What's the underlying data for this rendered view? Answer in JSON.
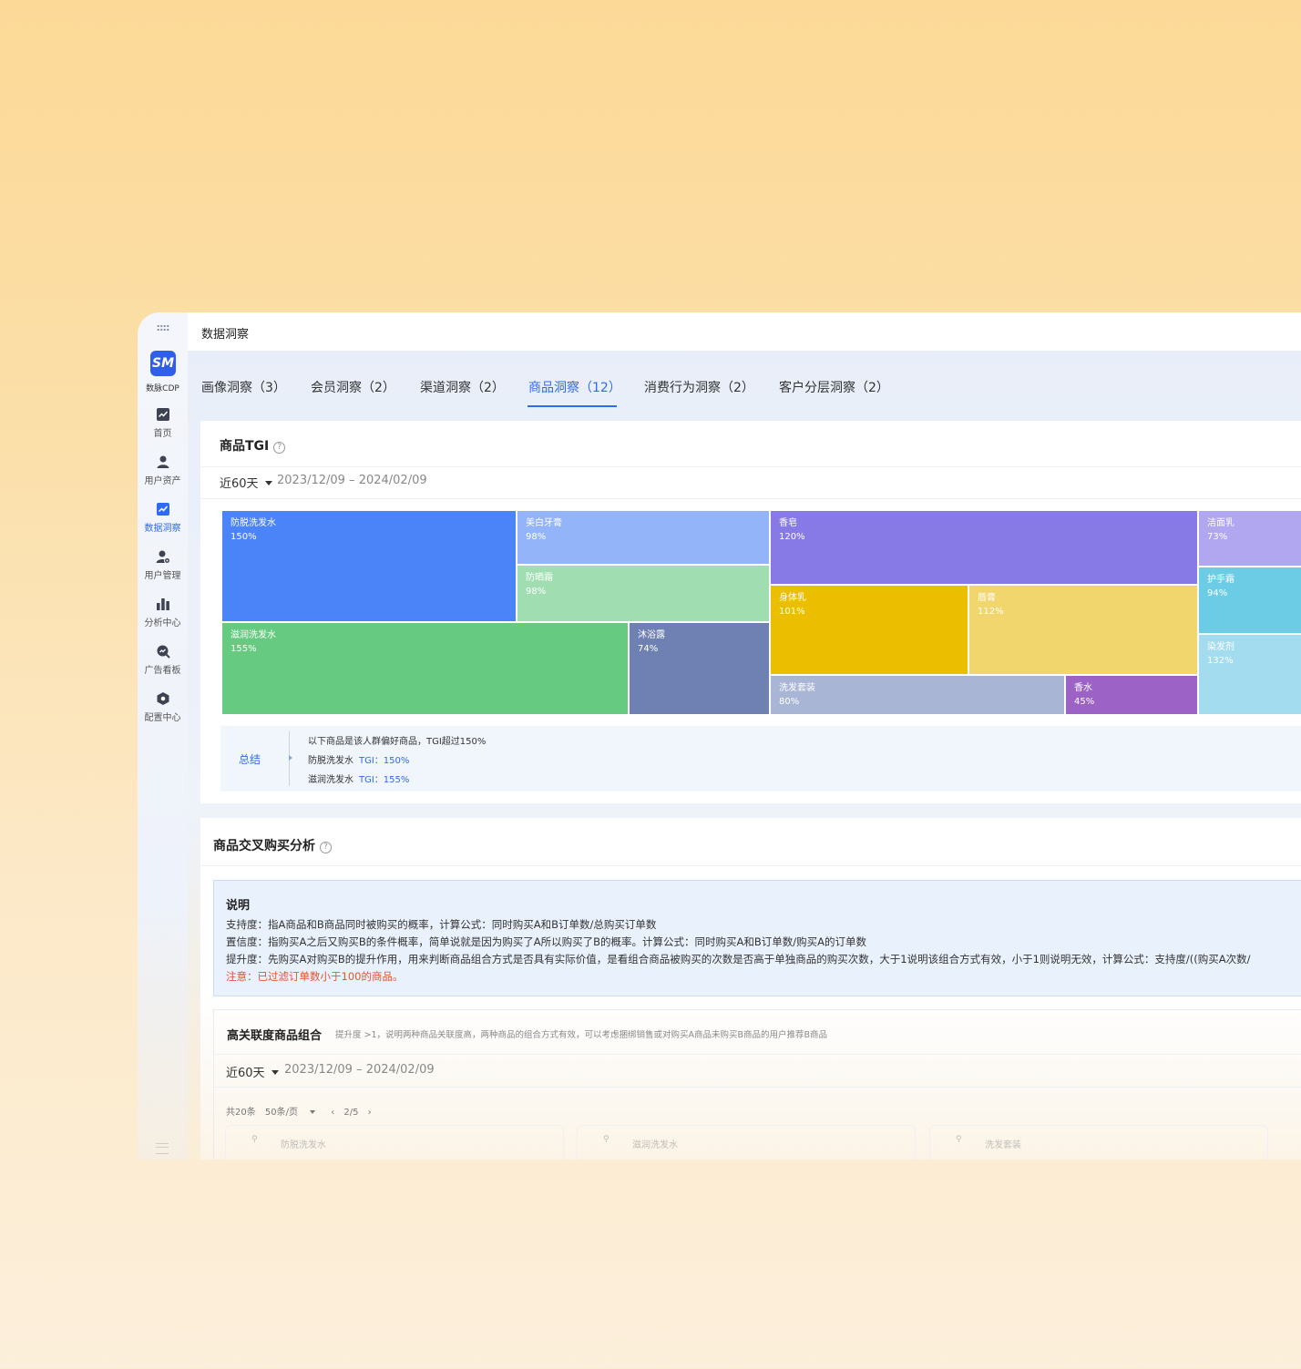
{
  "sidebar": {
    "logo_text": "SM",
    "logo_label": "数脉CDP",
    "items": [
      {
        "label": "首页",
        "icon": "chart-line-icon"
      },
      {
        "label": "用户资产",
        "icon": "user-icon"
      },
      {
        "label": "数据洞察",
        "icon": "insight-chart-icon",
        "active": true
      },
      {
        "label": "用户管理",
        "icon": "user-settings-icon"
      },
      {
        "label": "分析中心",
        "icon": "bar-chart-icon"
      },
      {
        "label": "广告看板",
        "icon": "ad-search-icon"
      },
      {
        "label": "配置中心",
        "icon": "hexagon-icon"
      }
    ]
  },
  "header": {
    "title": "数据洞察"
  },
  "tabs": [
    {
      "label": "画像洞察（3）"
    },
    {
      "label": "会员洞察（2）"
    },
    {
      "label": "渠道洞察（2）"
    },
    {
      "label": "商品洞察（12）",
      "active": true
    },
    {
      "label": "消费行为洞察（2）"
    },
    {
      "label": "客户分层洞察（2）"
    }
  ],
  "tgi_card": {
    "title": "商品TGI",
    "help": "?",
    "range_label": "近60天",
    "date_range": "2023/12/09 – 2024/02/09",
    "treemap": [
      {
        "name": "防脱洗发水",
        "value": "150%",
        "color": "#4b83f8"
      },
      {
        "name": "美白牙膏",
        "value": "98%",
        "color": "#93b4f8"
      },
      {
        "name": "防晒霜",
        "value": "98%",
        "color": "#a0deb1"
      },
      {
        "name": "滋润洗发水",
        "value": "155%",
        "color": "#66cb80"
      },
      {
        "name": "沐浴露",
        "value": "74%",
        "color": "#6f80b2"
      },
      {
        "name": "香皂",
        "value": "120%",
        "color": "#8779e6"
      },
      {
        "name": "身体乳",
        "value": "101%",
        "color": "#ebbf00"
      },
      {
        "name": "唇膏",
        "value": "112%",
        "color": "#f1d66d"
      },
      {
        "name": "洗发套装",
        "value": "80%",
        "color": "#a9b5d5"
      },
      {
        "name": "香水",
        "value": "45%",
        "color": "#9c62c6"
      },
      {
        "name": "洁面乳",
        "value": "73%",
        "color": "#b1a6f0"
      },
      {
        "name": "护手霜",
        "value": "94%",
        "color": "#6ccce6"
      },
      {
        "name": "染发剂",
        "value": "132%",
        "color": "#a4dcef"
      }
    ],
    "summary": {
      "label": "总结",
      "intro": "以下商品是该人群偏好商品，TGI超过150%",
      "rows": [
        {
          "name": "防脱洗发水",
          "tgi": "TGI：150%"
        },
        {
          "name": "滋润洗发水",
          "tgi": "TGI：155%"
        }
      ]
    }
  },
  "cross_card": {
    "title": "商品交叉购买分析",
    "help": "?",
    "explain": {
      "heading": "说明",
      "support": "支持度：指A商品和B商品同时被购买的概率，计算公式：同时购买A和B订单数/总购买订单数",
      "confidence": "置信度：指购买A之后又购买B的条件概率，简单说就是因为购买了A所以购买了B的概率。计算公式：同时购买A和B订单数/购买A的订单数",
      "lift": "提升度：先购买A对购买B的提升作用，用来判断商品组合方式是否具有实际价值，是看组合商品被购买的次数是否高于单独商品的购买次数，大于1说明该组合方式有效，小于1则说明无效，计算公式：支持度/((购买A次数/",
      "note": "注意：已过滤订单数小于100的商品。"
    },
    "combo": {
      "title": "高关联度商品组合",
      "desc": "提升度 >1，说明两种商品关联度高，两种商品的组合方式有效，可以考虑捆绑销售或对购买A商品未购买B商品的用户推荐B商品",
      "range_label": "近60天",
      "date_range": "2023/12/09 – 2024/02/09",
      "total": "共20条",
      "page_size": "50条/页",
      "page": "2/5",
      "cards": [
        "防脱洗发水",
        "滋润洗发水",
        "洗发套装"
      ]
    }
  },
  "colors": {
    "accent": "#2f6bf0",
    "warning": "#e5542f"
  }
}
